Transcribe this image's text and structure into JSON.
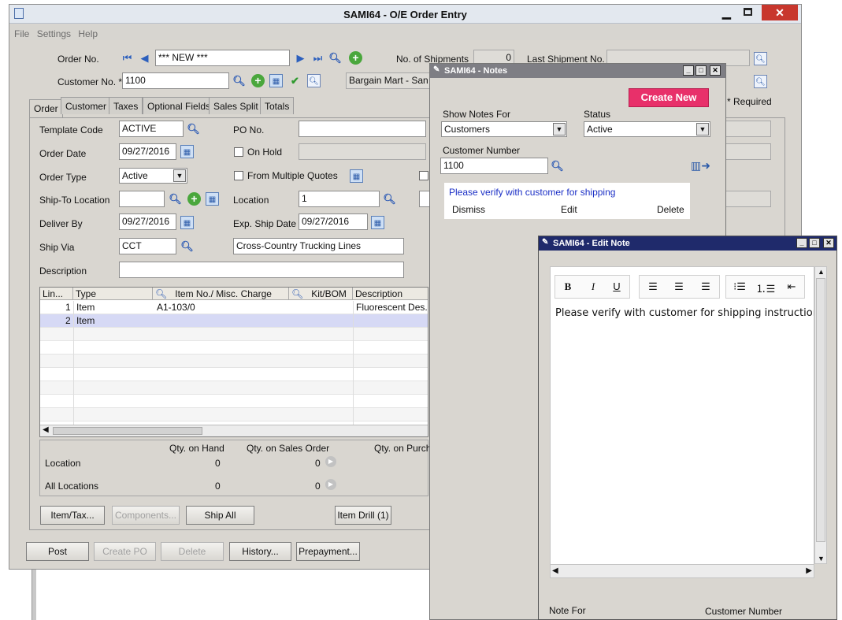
{
  "main": {
    "title": "SAMI64 - O/E Order Entry",
    "menu": [
      "File",
      "Settings",
      "Help"
    ],
    "order_no_label": "Order No.",
    "order_no_value": "*** NEW ***",
    "no_shipments_label": "No. of Shipments",
    "no_shipments_value": "0",
    "last_shipment_label": "Last Shipment No.",
    "customer_no_label": "Customer No. *",
    "customer_no_value": "1100",
    "customer_name": "Bargain Mart - San D",
    "required_label": "* Required",
    "tabs": [
      "Order",
      "Customer",
      "Taxes",
      "Optional Fields",
      "Sales Split",
      "Totals"
    ],
    "template_code_label": "Template Code",
    "template_code_value": "ACTIVE",
    "po_no_label": "PO No.",
    "order_date_label": "Order Date",
    "order_date_value": "09/27/2016",
    "on_hold_label": "On Hold",
    "order_type_label": "Order Type",
    "order_type_value": "Active",
    "multiple_quotes_label": "From Multiple Quotes",
    "ship_to_label": "Ship-To Location",
    "location_label": "Location",
    "location_value": "1",
    "deliver_by_label": "Deliver By",
    "deliver_by_value": "09/27/2016",
    "exp_ship_label": "Exp. Ship Date",
    "exp_ship_value": "09/27/2016",
    "ship_via_label": "Ship Via",
    "ship_via_value": "CCT",
    "ship_via_desc": "Cross-Country Trucking Lines",
    "description_label": "Description",
    "grid_headers": [
      "Lin...",
      "Type",
      "Item No./ Misc. Charge",
      "Kit/BOM",
      "Description"
    ],
    "grid_rows": [
      {
        "line": "1",
        "type": "Item",
        "item": "A1-103/0",
        "desc": "Fluorescent Des..."
      },
      {
        "line": "2",
        "type": "Item",
        "item": "",
        "desc": ""
      }
    ],
    "qty_hand_label": "Qty. on Hand",
    "qty_so_label": "Qty. on Sales Order",
    "qty_po_label": "Qty. on Purch",
    "loc_row_label": "Location",
    "loc_hand": "0",
    "loc_so": "0",
    "all_row_label": "All Locations",
    "all_hand": "0",
    "all_so": "0",
    "buttons": {
      "item_tax": "Item/Tax...",
      "components": "Components...",
      "ship_all": "Ship All",
      "item_drill": "Item Drill (1)",
      "post": "Post",
      "create_po": "Create PO",
      "delete": "Delete",
      "history": "History...",
      "prepayment": "Prepayment..."
    }
  },
  "notes": {
    "title": "SAMI64 - Notes",
    "create_new": "Create New",
    "show_for_label": "Show Notes For",
    "show_for_value": "Customers",
    "status_label": "Status",
    "status_value": "Active",
    "cust_num_label": "Customer Number",
    "cust_num_value": "1100",
    "note_text": "Please verify with customer for shipping",
    "dismiss": "Dismiss",
    "edit": "Edit",
    "delete": "Delete"
  },
  "edit": {
    "title": "SAMI64 - Edit Note",
    "content": "Please verify with customer for shipping instructions t",
    "note_for_label": "Note For",
    "cust_num_label": "Customer Number"
  }
}
